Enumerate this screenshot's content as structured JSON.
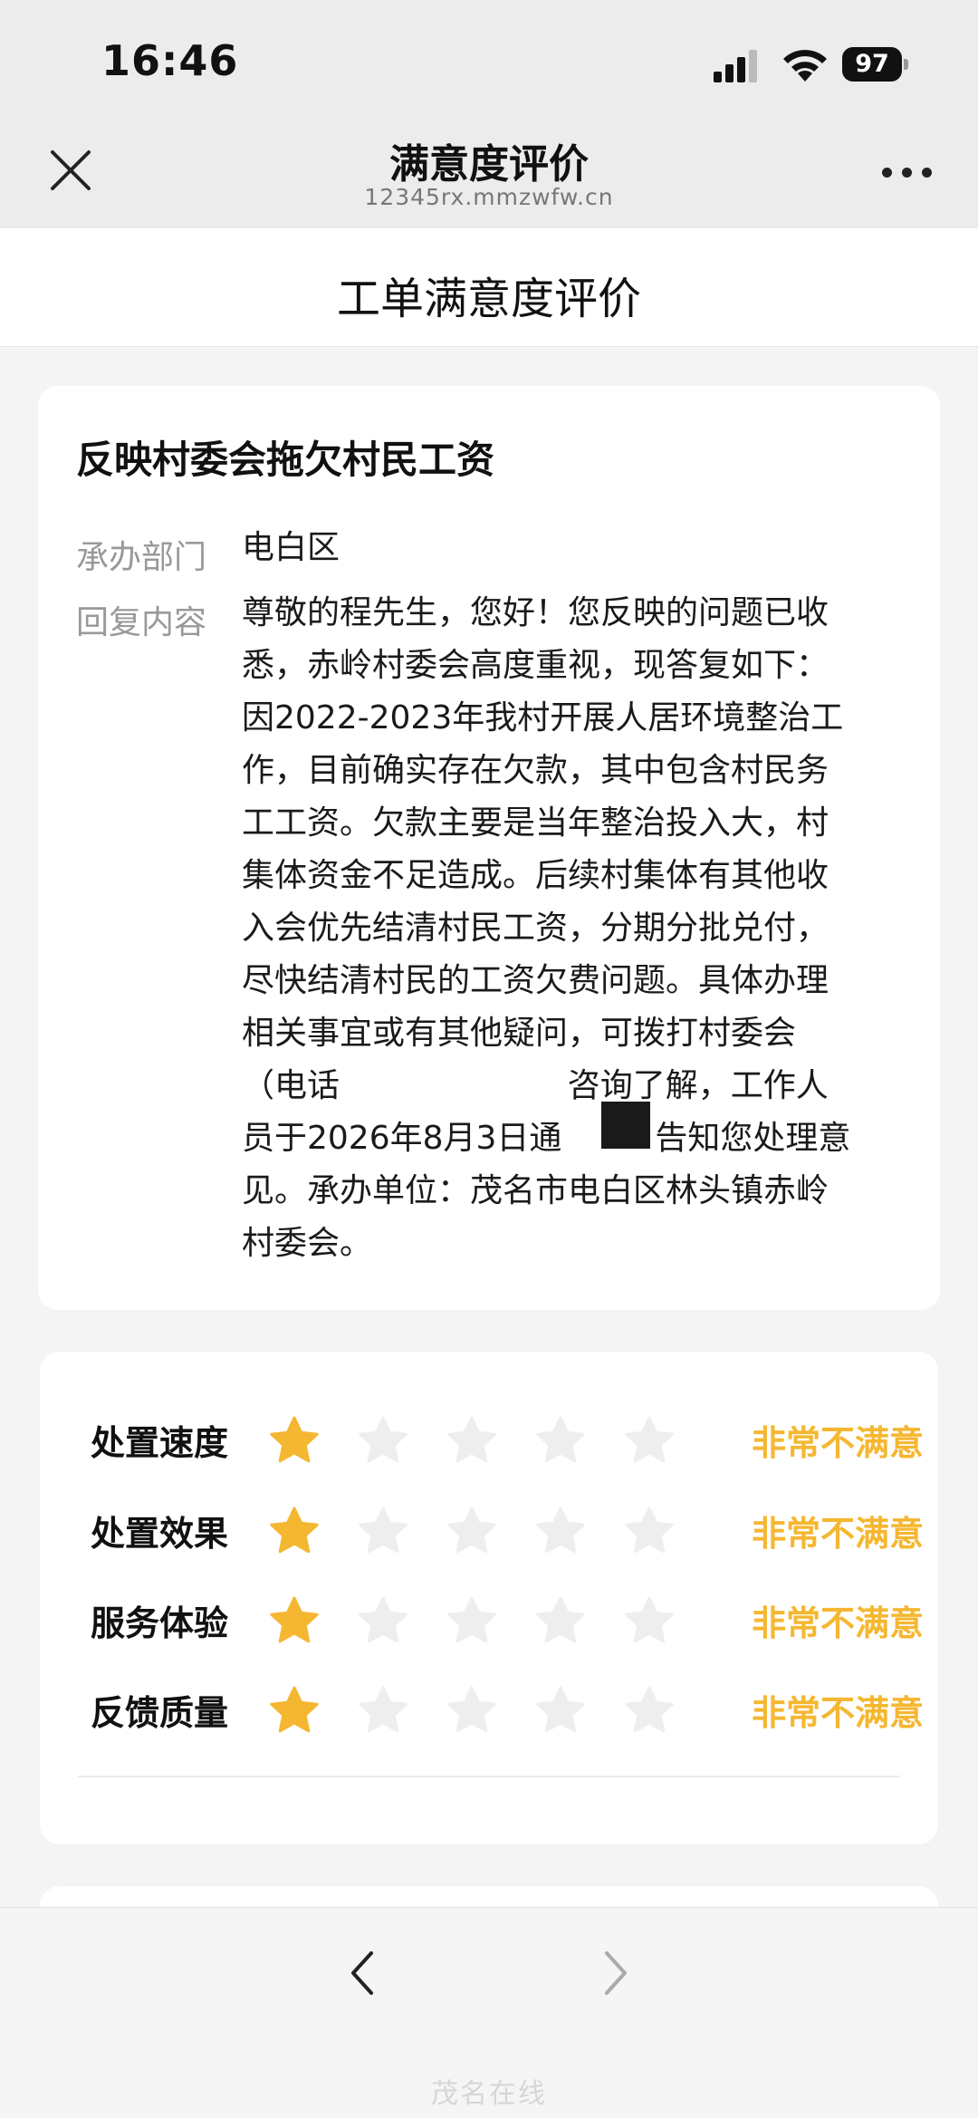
{
  "status_bar": {
    "time": "16:46",
    "battery": "97"
  },
  "nav": {
    "title": "满意度评价",
    "url": "12345rx.mmzwfw.cn"
  },
  "page": {
    "title": "工单满意度评价"
  },
  "ticket": {
    "title": "反映村委会拖欠村民工资",
    "dept_label": "承办部门",
    "dept_value": "电白区",
    "reply_label": "回复内容",
    "reply_lines": [
      "尊敬的程先生，您好！您反映的问题已收",
      "悉，赤岭村委会高度重视，现答复如下：",
      "因2022-2023年我村开展人居环境整治工",
      "作，目前确实存在欠款，其中包含村民务",
      "工工资。欠款主要是当年整治投入大，村",
      "集体资金不足造成。后续村集体有其他收",
      "入会优先结清村民工资，分期分批兑付，",
      "尽快结清村民的工资欠费问题。具体办理",
      "相关事宜或有其他疑问，可拨打村委会",
      "（电话                      咨询了解，工作人",
      "员于2026年8月3日通         告知您处理意",
      "见。承办单位：茂名市电白区林头镇赤岭",
      "村委会。"
    ]
  },
  "ratings": [
    {
      "label": "处置速度",
      "score": 1,
      "max": 5,
      "result": "非常不满意"
    },
    {
      "label": "处置效果",
      "score": 1,
      "max": 5,
      "result": "非常不满意"
    },
    {
      "label": "服务体验",
      "score": 1,
      "max": 5,
      "result": "非常不满意"
    },
    {
      "label": "反馈质量",
      "score": 1,
      "max": 5,
      "result": "非常不满意"
    }
  ],
  "colors": {
    "star_filled": "#f5b731",
    "star_empty": "#eeeeee",
    "rating_text": "#f5b731"
  },
  "icons": {
    "close": "close-icon",
    "more": "more-icon",
    "back": "chevron-left-icon",
    "forward": "chevron-right-icon"
  },
  "watermark": "茂名在线"
}
